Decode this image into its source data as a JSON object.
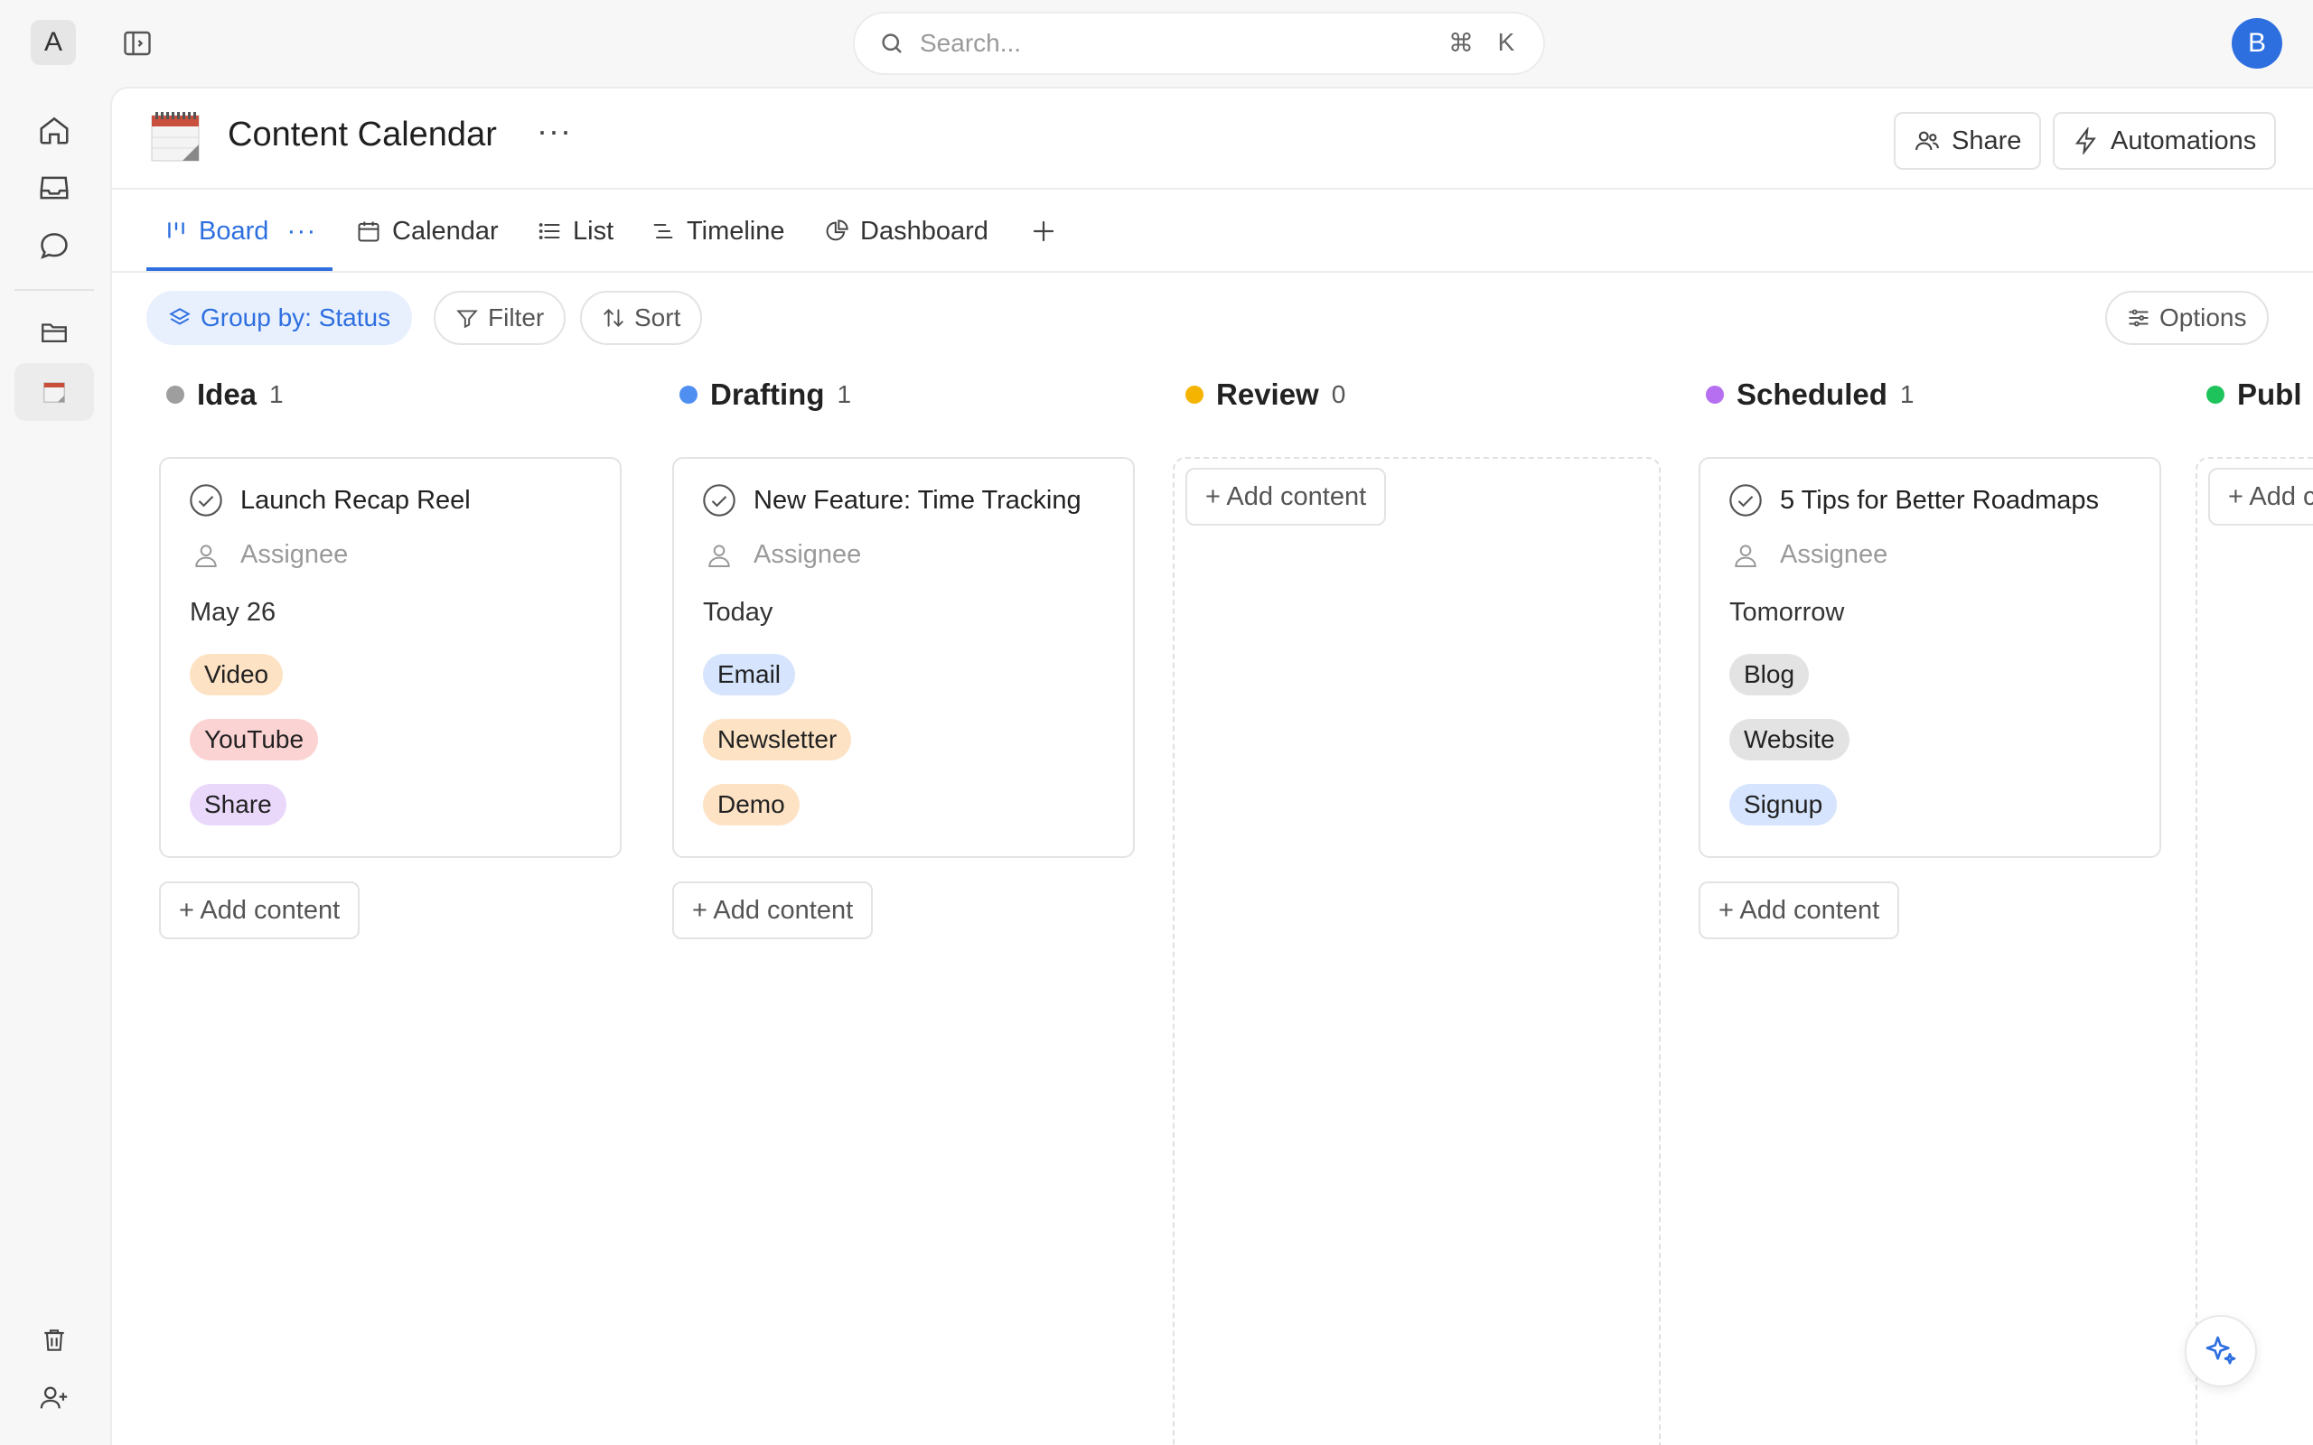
{
  "workspace": {
    "initial": "A"
  },
  "user": {
    "initial": "B"
  },
  "search": {
    "placeholder": "Search...",
    "shortcut_mod": "⌘",
    "shortcut_key": "K"
  },
  "page": {
    "title": "Content Calendar",
    "more": "···"
  },
  "header_actions": {
    "share": "Share",
    "automations": "Automations"
  },
  "tabs": [
    {
      "label": "Board",
      "active": true
    },
    {
      "label": "Calendar"
    },
    {
      "label": "List"
    },
    {
      "label": "Timeline"
    },
    {
      "label": "Dashboard"
    }
  ],
  "toolbar": {
    "group_by": "Group by: Status",
    "filter": "Filter",
    "sort": "Sort",
    "options": "Options"
  },
  "columns": [
    {
      "name": "Idea",
      "count": "1",
      "color": "#9e9e9e",
      "card": {
        "title": "Launch Recap Reel",
        "assignee": "Assignee",
        "date": "May 26",
        "tags": [
          {
            "label": "Video",
            "color": "#fde2c4"
          },
          {
            "label": "YouTube",
            "color": "#fcd3d3"
          },
          {
            "label": "Share",
            "color": "#ead8fb"
          }
        ]
      },
      "add_label": "+ Add content"
    },
    {
      "name": "Drafting",
      "count": "1",
      "color": "#4f8ff2",
      "card": {
        "title": "New Feature: Time Tracking",
        "assignee": "Assignee",
        "date": "Today",
        "tags": [
          {
            "label": "Email",
            "color": "#d6e4fd"
          },
          {
            "label": "Newsletter",
            "color": "#fde2c4"
          },
          {
            "label": "Demo",
            "color": "#fde2c4"
          }
        ]
      },
      "add_label": "+ Add content"
    },
    {
      "name": "Review",
      "count": "0",
      "color": "#f5b400",
      "add_label": "+ Add content"
    },
    {
      "name": "Scheduled",
      "count": "1",
      "color": "#b56ff0",
      "card": {
        "title": "5 Tips for Better Roadmaps",
        "assignee": "Assignee",
        "date": "Tomorrow",
        "tags": [
          {
            "label": "Blog",
            "color": "#e3e3e3"
          },
          {
            "label": "Website",
            "color": "#e3e3e3"
          },
          {
            "label": "Signup",
            "color": "#d6e4fd"
          }
        ]
      },
      "add_label": "+ Add content"
    },
    {
      "name": "Publ",
      "color": "#1fc35c",
      "add_label": "+ Add c"
    }
  ]
}
